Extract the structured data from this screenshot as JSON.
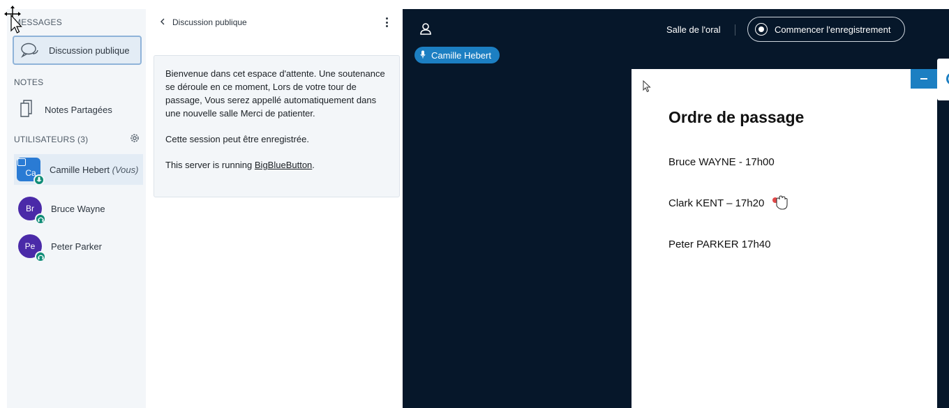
{
  "sidebar": {
    "messages_title": "MESSAGES",
    "chat_item_label": "Discussion publique",
    "notes_title": "NOTES",
    "notes_item_label": "Notes Partagées",
    "users_title": "UTILISATEURS (3)",
    "users": [
      {
        "initials": "Ca",
        "name": "Camille Hebert",
        "suffix": "(Vous)"
      },
      {
        "initials": "Br",
        "name": "Bruce Wayne"
      },
      {
        "initials": "Pe",
        "name": "Peter Parker"
      }
    ]
  },
  "chat": {
    "header": "Discussion publique",
    "welcome": "Bienvenue dans cet espace d'attente. Une soutenance se déroule en ce moment, Lors de votre tour de passage, Vous serez appellé automatiquement dans une nouvelle salle Merci de patienter.",
    "recording_notice": "Cette session peut être enregistrée.",
    "server_prefix": "This server is running ",
    "server_link": "BigBlueButton",
    "server_suffix": "."
  },
  "main": {
    "room_name": "Salle de l'oral",
    "record_button": "Commencer l'enregistrement",
    "talker": "Camille Hebert"
  },
  "slide": {
    "title": "Ordre de passage",
    "lines": [
      "Bruce WAYNE -  17h00",
      "Clark KENT – 17h20",
      "Peter PARKER 17h40"
    ]
  },
  "colors": {
    "sidebar_bg": "#f3f6f9",
    "main_bg": "#06172a",
    "accent": "#1c7fc2",
    "avatar_purple": "#4a2aa8",
    "badge_green": "#0f8c77"
  }
}
